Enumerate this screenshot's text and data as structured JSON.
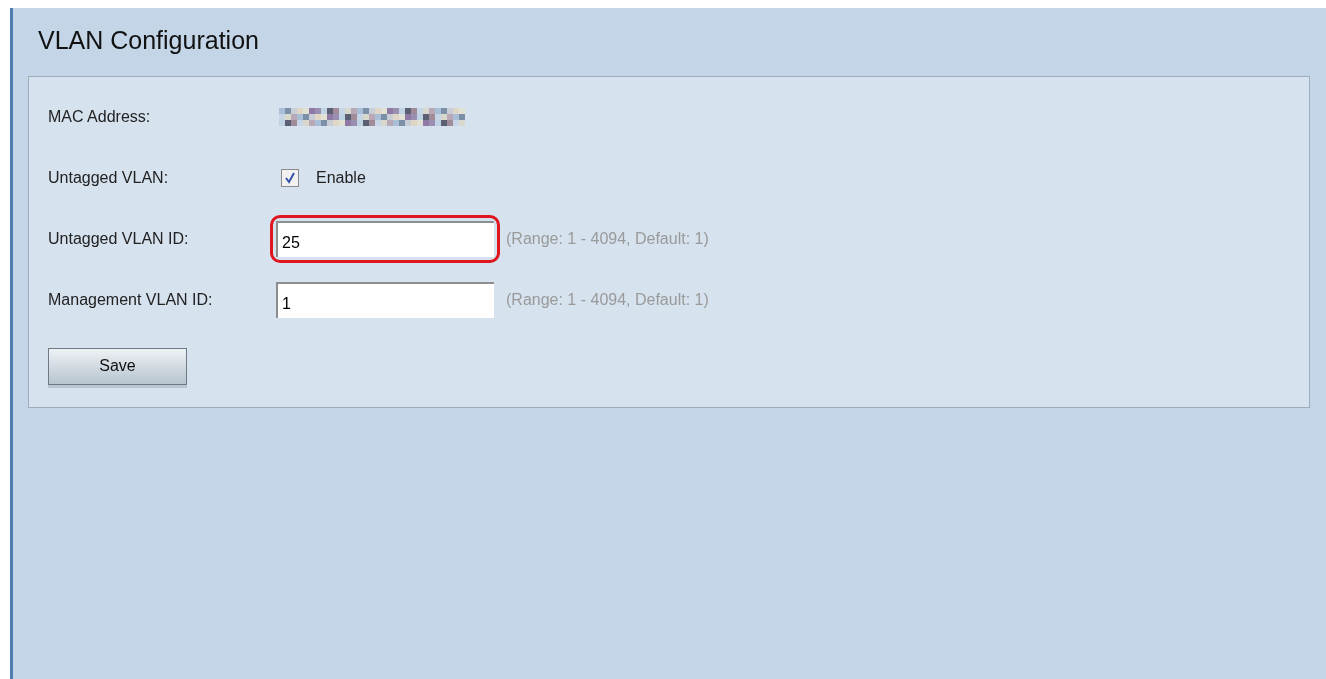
{
  "page": {
    "title": "VLAN Configuration"
  },
  "fields": [
    {
      "kind": "masked",
      "label": "MAC Address:"
    },
    {
      "kind": "checkbox",
      "label": "Untagged VLAN:",
      "checked": true,
      "option": "Enable"
    },
    {
      "kind": "text",
      "label": "Untagged VLAN ID:",
      "value": "25",
      "hint": "(Range: 1 - 4094, Default: 1)",
      "highlighted": true
    },
    {
      "kind": "text",
      "label": "Management VLAN ID:",
      "value": "1",
      "hint": "(Range: 1 - 4094, Default: 1)",
      "highlighted": false
    }
  ],
  "buttons": [
    "Save"
  ]
}
